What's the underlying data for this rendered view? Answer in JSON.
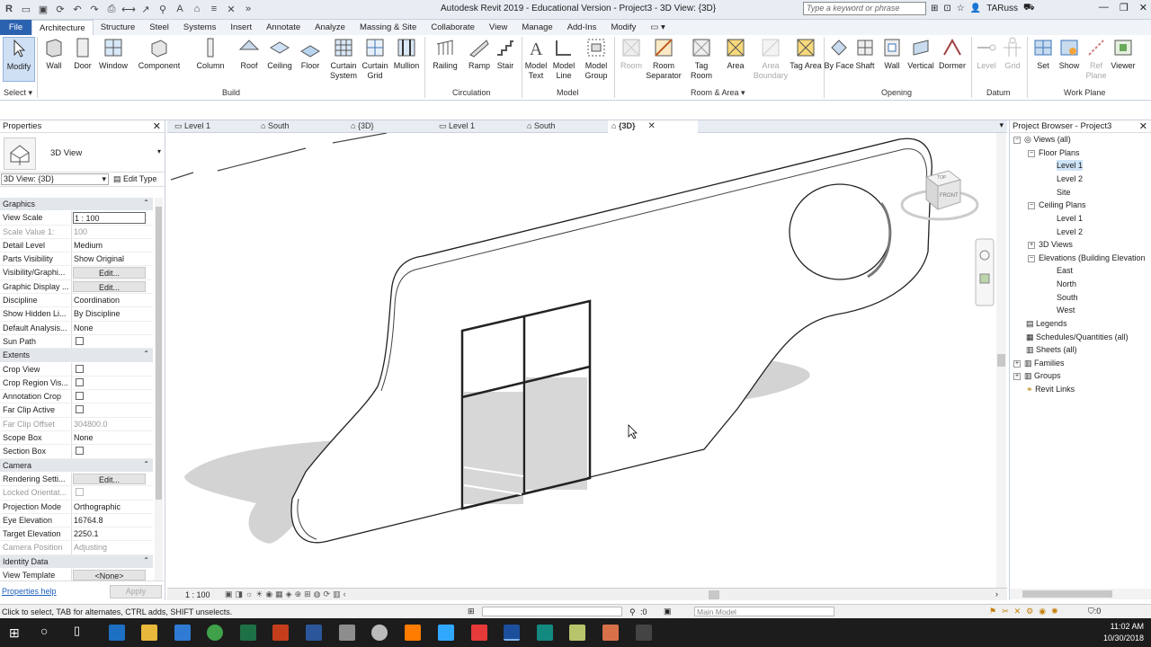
{
  "app": {
    "title": "Autodesk Revit 2019 - Educational Version - Project3 - 3D View: {3D}",
    "search_placeholder": "Type a keyword or phrase",
    "user": "TARuss"
  },
  "tabs": [
    "File",
    "Architecture",
    "Structure",
    "Steel",
    "Systems",
    "Insert",
    "Annotate",
    "Analyze",
    "Massing & Site",
    "Collaborate",
    "View",
    "Manage",
    "Add-Ins",
    "Modify"
  ],
  "ribbon": {
    "tools": [
      {
        "label": "Modify"
      },
      {
        "label": "Wall"
      },
      {
        "label": "Door"
      },
      {
        "label": "Window"
      },
      {
        "label": "Component"
      },
      {
        "label": "Column"
      },
      {
        "label": "Roof"
      },
      {
        "label": "Ceiling"
      },
      {
        "label": "Floor"
      },
      {
        "label": "Curtain System"
      },
      {
        "label": "Curtain Grid"
      },
      {
        "label": "Mullion"
      },
      {
        "label": "Railing"
      },
      {
        "label": "Ramp"
      },
      {
        "label": "Stair"
      },
      {
        "label": "Model Text"
      },
      {
        "label": "Model Line"
      },
      {
        "label": "Model Group"
      },
      {
        "label": "Room"
      },
      {
        "label": "Room Separator"
      },
      {
        "label": "Tag Room"
      },
      {
        "label": "Area"
      },
      {
        "label": "Area Boundary"
      },
      {
        "label": "Tag Area"
      },
      {
        "label": "By Face"
      },
      {
        "label": "Shaft"
      },
      {
        "label": "Wall"
      },
      {
        "label": "Vertical"
      },
      {
        "label": "Dormer"
      },
      {
        "label": "Level"
      },
      {
        "label": "Grid"
      },
      {
        "label": "Set"
      },
      {
        "label": "Show"
      },
      {
        "label": "Ref Plane"
      },
      {
        "label": "Viewer"
      }
    ],
    "panels": [
      "Select",
      "Build",
      "Circulation",
      "Model",
      "Room & Area",
      "Opening",
      "Datum",
      "Work Plane"
    ]
  },
  "properties": {
    "title": "Properties",
    "type": "3D View",
    "filter": "3D View: {3D}",
    "edit_type": "Edit Type",
    "sections": {
      "graphics": "Graphics",
      "extents": "Extents",
      "camera": "Camera",
      "identity": "Identity Data"
    },
    "rows": {
      "view_scale": [
        "View Scale",
        "1 : 100"
      ],
      "scale_value": [
        "Scale Value    1:",
        "100"
      ],
      "detail_level": [
        "Detail Level",
        "Medium"
      ],
      "parts_visibility": [
        "Parts Visibility",
        "Show Original"
      ],
      "visibility_graphics": [
        "Visibility/Graphi...",
        "Edit..."
      ],
      "graphic_display": [
        "Graphic Display ...",
        "Edit..."
      ],
      "discipline": [
        "Discipline",
        "Coordination"
      ],
      "show_hidden": [
        "Show Hidden Li...",
        "By Discipline"
      ],
      "default_analysis": [
        "Default Analysis...",
        "None"
      ],
      "sun_path": [
        "Sun Path",
        ""
      ],
      "crop_view": [
        "Crop View",
        ""
      ],
      "crop_region": [
        "Crop Region Vis...",
        ""
      ],
      "annotation_crop": [
        "Annotation Crop",
        ""
      ],
      "far_clip_active": [
        "Far Clip Active",
        ""
      ],
      "far_clip_offset": [
        "Far Clip Offset",
        "304800.0"
      ],
      "scope_box": [
        "Scope Box",
        "None"
      ],
      "section_box": [
        "Section Box",
        ""
      ],
      "rendering_settings": [
        "Rendering Setti...",
        "Edit..."
      ],
      "locked_orientation": [
        "Locked Orientat...",
        ""
      ],
      "projection_mode": [
        "Projection Mode",
        "Orthographic"
      ],
      "eye_elevation": [
        "Eye Elevation",
        "16764.8"
      ],
      "target_elevation": [
        "Target Elevation",
        "2250.1"
      ],
      "camera_position": [
        "Camera Position",
        "Adjusting"
      ],
      "view_template": [
        "View Template",
        "<None>"
      ]
    },
    "help": "Properties help",
    "apply": "Apply"
  },
  "view_tabs": [
    "Level 1",
    "South",
    "{3D}",
    "Level 1",
    "South",
    "{3D}"
  ],
  "viewcube": {
    "top": "TOP",
    "front": "FRONT"
  },
  "view_control": {
    "scale": "1 : 100"
  },
  "browser": {
    "title": "Project Browser - Project3",
    "nodes": {
      "views": "Views (all)",
      "floor_plans": "Floor Plans",
      "fp_level1": "Level 1",
      "fp_level2": "Level 2",
      "fp_site": "Site",
      "ceiling_plans": "Ceiling Plans",
      "cp_level1": "Level 1",
      "cp_level2": "Level 2",
      "views3d": "3D Views",
      "elevations": "Elevations (Building Elevation",
      "east": "East",
      "north": "North",
      "south": "South",
      "west": "West",
      "legends": "Legends",
      "schedules": "Schedules/Quantities (all)",
      "sheets": "Sheets (all)",
      "families": "Families",
      "groups": "Groups",
      "links": "Revit Links"
    }
  },
  "status": {
    "message": "Click to select, TAB for alternates, CTRL adds, SHIFT unselects.",
    "zero": ":0",
    "model": "Main Model"
  },
  "clock": {
    "time": "11:02 AM",
    "date": "10/30/2018"
  }
}
